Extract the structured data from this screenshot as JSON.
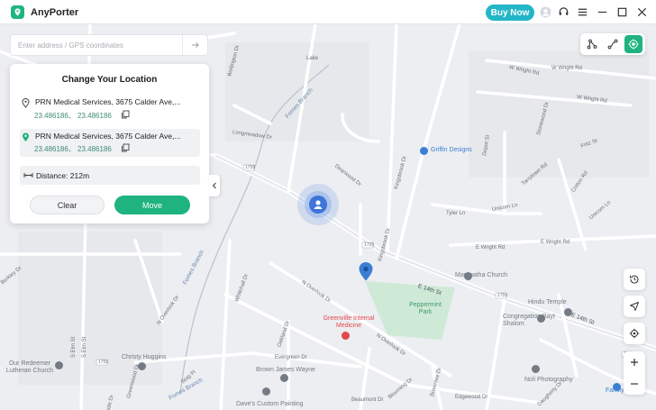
{
  "app": {
    "title": "AnyPorter",
    "buy_now": "Buy Now"
  },
  "search": {
    "placeholder": "Enter address / GPS coordinates"
  },
  "panel": {
    "title": "Change Your Location",
    "start": {
      "name": "PRN Medical Services, 3675 Calder Ave,...",
      "coords": "23.486186、 23.486186"
    },
    "end": {
      "name": "PRN Medical Services, 3675 Calder Ave,...",
      "coords": "23.486186、 23.486186"
    },
    "distance": "Distance: 212m",
    "clear": "Clear",
    "move": "Move"
  },
  "map": {
    "streets": [
      "Fomes Branch",
      "Fomes Branch",
      "Fomes Branch",
      "W Wright Rd",
      "W Wright Rd",
      "W Wright Rd",
      "E Wright Rd",
      "E Wright Rd",
      "E 14th St",
      "E 14th St",
      "N Overlook Dr",
      "N Overlook Dr",
      "N Overlook Dr",
      "Dearwood Dr",
      "Evergreen Dr",
      "Beaumont Dr",
      "Edgewood Dr",
      "Tyler Ln",
      "Unicorn Ln",
      "Unicorn Ln",
      "Brownlee Dr",
      "Kingsbrook Dr",
      "Kingsbrook Dr",
      "Cotton Rd",
      "Depot St",
      "Fritz St",
      "S Elm St",
      "S Elm St",
      "Berkley Dr",
      "Hillside Dr",
      "Greenwood Dr",
      "Longmeadow Dr",
      "Whitehall Dr",
      "Wellington Dr",
      "Tarrytown Rd",
      "Oakland Dr",
      "Stonewood Dr",
      "Lake",
      "Stag Pl",
      "Blooming Dr",
      "Daugherty Dr"
    ],
    "roads": [
      "1755",
      "1755",
      "1755",
      "1755",
      "1755"
    ],
    "pois": [
      {
        "label": "Griffin Designs",
        "color": "#3b7fd4"
      },
      {
        "label": "Maranatha Church",
        "color": "#737b84"
      },
      {
        "label": "Hindu Temple",
        "color": "#737b84"
      },
      {
        "label": "Congregation Bayt Shalom",
        "color": "#737b84"
      },
      {
        "label": "Peppermint Park",
        "color": "#3e9a6a"
      },
      {
        "label": "Greenville Internal Medicine",
        "color": "#e3484b"
      },
      {
        "label": "Our Redeemer Lutheran Church",
        "color": "#737b84"
      },
      {
        "label": "Christy Huggins",
        "color": "#737b84"
      },
      {
        "label": "Brown James Wayne",
        "color": "#737b84"
      },
      {
        "label": "Dave's Custom Painting",
        "color": "#737b84"
      },
      {
        "label": "Noli Photography",
        "color": "#737b84"
      },
      {
        "label": "Family Fare",
        "color": "#3b7fd4"
      }
    ]
  },
  "colors": {
    "accent": "#1fb37f",
    "buy": "#22b6c8",
    "coords": "#3d8b73"
  },
  "icons": [
    "logo-icon",
    "user-icon",
    "support-icon",
    "menu-icon",
    "minimize-icon",
    "maximize-icon",
    "close-icon",
    "arrow-right-icon",
    "location-pin-icon",
    "copy-icon",
    "distance-icon",
    "chevron-left-icon",
    "multi-stop-route-icon",
    "two-spot-route-icon",
    "teleport-icon",
    "history-icon",
    "cursor-icon",
    "locate-icon",
    "zoom-in-icon",
    "zoom-out-icon"
  ]
}
